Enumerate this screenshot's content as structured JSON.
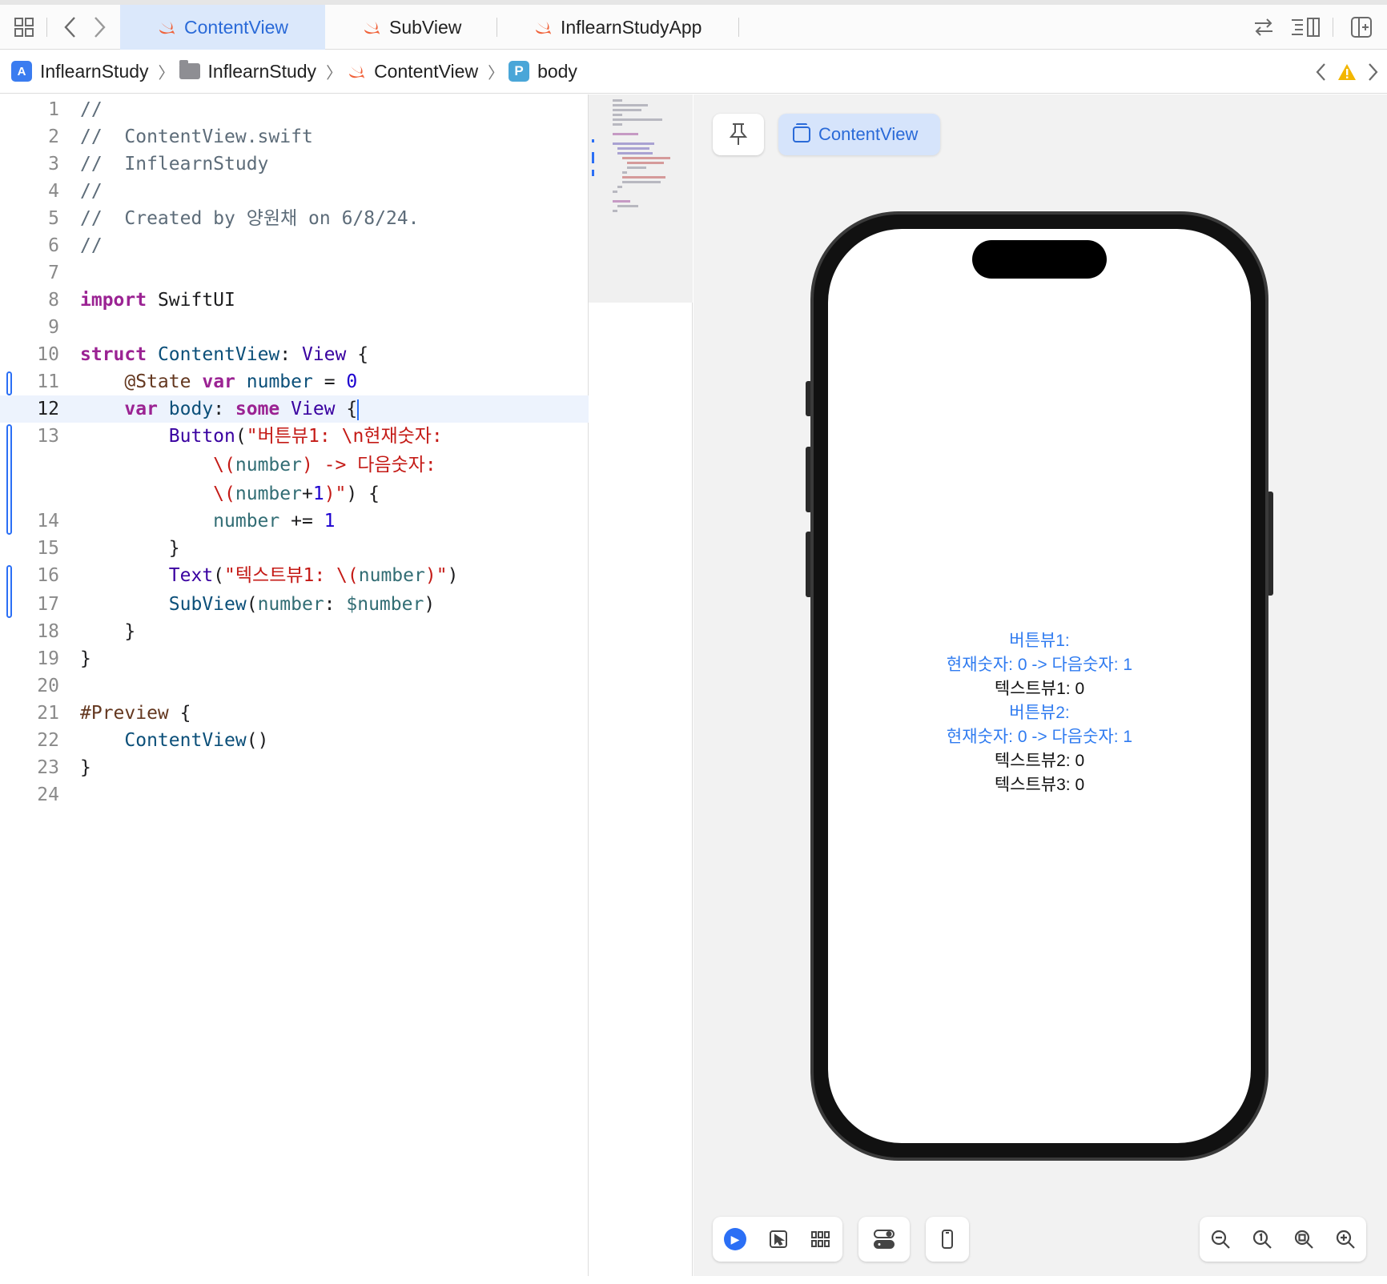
{
  "tabs": [
    {
      "label": "ContentView",
      "active": true
    },
    {
      "label": "SubView",
      "active": false
    },
    {
      "label": "InflearnStudyApp",
      "active": false
    }
  ],
  "breadcrumb": {
    "project": "InflearnStudy",
    "folder": "InflearnStudy",
    "file": "ContentView",
    "symbol_badge": "P",
    "symbol": "body"
  },
  "editor": {
    "current_line": 12,
    "line_numbers": [
      "1",
      "2",
      "3",
      "4",
      "5",
      "6",
      "7",
      "8",
      "9",
      "10",
      "11",
      "12",
      "13",
      "",
      "",
      "14",
      "15",
      "16",
      "17",
      "18",
      "19",
      "20",
      "21",
      "22",
      "23",
      "24"
    ]
  },
  "preview": {
    "selected_preview": "ContentView",
    "screen_lines": [
      {
        "text": "버튼뷰1:",
        "style": "button"
      },
      {
        "text": "현재숫자: 0 -> 다음숫자: 1",
        "style": "button"
      },
      {
        "text": "텍스트뷰1: 0",
        "style": "text"
      },
      {
        "text": "버튼뷰2:",
        "style": "button"
      },
      {
        "text": "현재숫자: 0 -> 다음숫자: 1",
        "style": "button"
      },
      {
        "text": "텍스트뷰2: 0",
        "style": "text"
      },
      {
        "text": "텍스트뷰3: 0",
        "style": "text"
      }
    ]
  },
  "colors": {
    "accent": "#2b6ff5",
    "tab_active_bg": "#dbe8fb",
    "preview_bg": "#f2f2f2",
    "warning": "#f2b600"
  },
  "icons": {
    "navigator": "grid-icon",
    "back": "chevron-left-icon",
    "forward": "chevron-right-icon",
    "swap": "swap-arrows-icon",
    "inspector": "inspector-icon",
    "add_editor": "add-editor-icon",
    "warning": "warning-icon",
    "pin": "pin-icon",
    "live": "play-icon",
    "select": "select-cursor-icon",
    "variants": "variants-grid-icon",
    "settings": "toggle-icon",
    "device": "device-icon",
    "zoom_out": "zoom-out-icon",
    "zoom_actual": "zoom-actual-icon",
    "zoom_fit": "zoom-fit-icon",
    "zoom_in": "zoom-in-icon"
  }
}
